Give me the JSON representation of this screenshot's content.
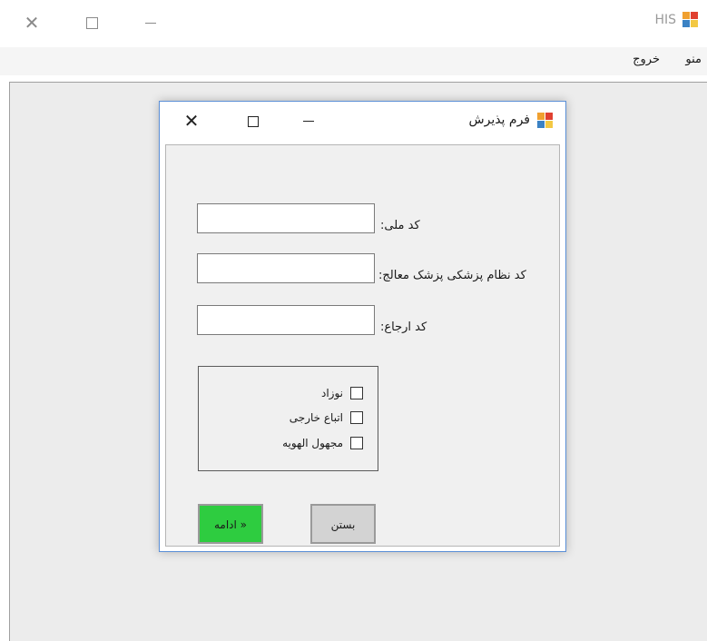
{
  "app": {
    "title": "HIS",
    "controls": {
      "close_icon": "close-icon",
      "maximize_icon": "maximize-icon",
      "minimize_icon": "minimize-icon"
    }
  },
  "menubar": {
    "items": [
      {
        "label": "منو"
      },
      {
        "label": "خروج"
      }
    ]
  },
  "form": {
    "title": "فرم پذیرش",
    "fields": [
      {
        "label": "کد ملی:",
        "value": "",
        "placeholder": ""
      },
      {
        "label": "کد نظام پزشکی پزشک معالج:",
        "value": "",
        "placeholder": ""
      },
      {
        "label": "کد ارجاع:",
        "value": "",
        "placeholder": ""
      }
    ],
    "checkboxes": [
      {
        "label": "نوزاد",
        "checked": false
      },
      {
        "label": "اتباع خارجی",
        "checked": false
      },
      {
        "label": "مجهول الهویه",
        "checked": false
      }
    ],
    "buttons": {
      "continue_label": "ادامه »",
      "close_label": "بستن"
    }
  },
  "colors": {
    "continue_button": "#2ecc40",
    "close_button": "#d3d3d3",
    "child_border": "#5b8fd6"
  }
}
